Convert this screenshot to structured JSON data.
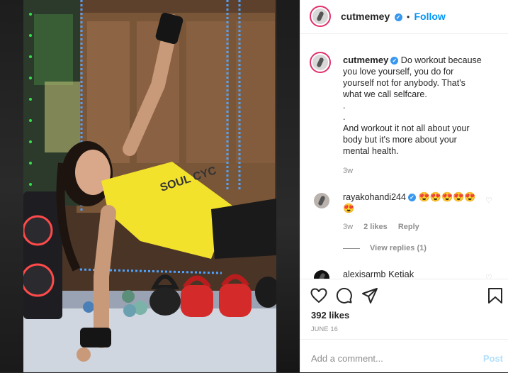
{
  "post": {
    "username": "cutmemey",
    "verified_mark": "✓",
    "follow_separator": "•",
    "follow_label": "Follow"
  },
  "caption": {
    "username": "cutmemey",
    "lines": [
      "Do workout because",
      "you love yourself, you do for",
      "yourself not for anybody. That's",
      "what we call selfcare.",
      ".",
      ".",
      "And workout it not all about your",
      "body but it's more about your",
      "mental health."
    ],
    "time": "3w"
  },
  "comments": [
    {
      "username": "rayakohandi244",
      "text": "😍😍😍😍😍😍",
      "time": "3w",
      "likes": "2 likes",
      "reply_label": "Reply",
      "view_replies": "View replies (1)"
    },
    {
      "username": "alexisarmb",
      "text": "Ketiak"
    }
  ],
  "actions": {
    "likes": "392 likes",
    "date": "JUNE 16"
  },
  "comment_box": {
    "placeholder": "Add a comment...",
    "post_label": "Post"
  },
  "colors": {
    "accent": "#0095f6",
    "shirt": "#f3e22c",
    "led": "#3a8cff",
    "kettlebell": "#d42a2a"
  },
  "icons": [
    "heart-icon",
    "comment-icon",
    "share-icon",
    "bookmark-icon",
    "verified-icon"
  ]
}
